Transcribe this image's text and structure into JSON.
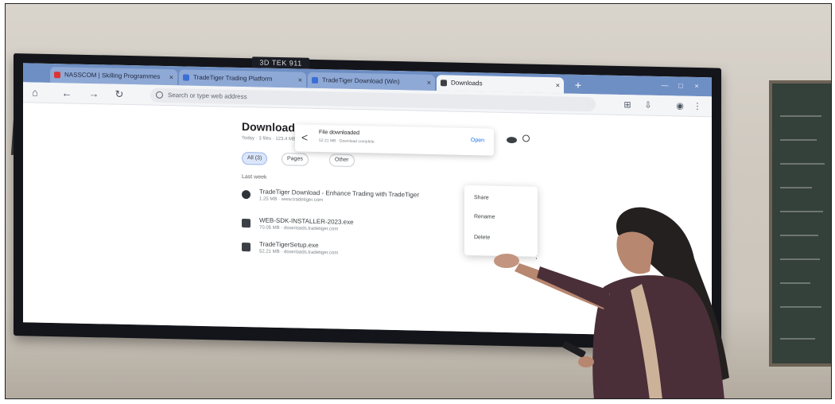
{
  "tv": {
    "label": "3D TEK 911"
  },
  "browser": {
    "tabs": [
      {
        "label": "NASSCOM | Skilling Programmes"
      },
      {
        "label": "TradeTiger Trading Platform"
      },
      {
        "label": "TradeTiger Download (Win)"
      },
      {
        "label": "Downloads"
      }
    ],
    "omnibox_placeholder": "Search or type web address",
    "new_tab_symbol": "+"
  },
  "downloads": {
    "title": "Download",
    "subtitle": "Today · 3 files · 123.4 MB",
    "filters": [
      "All (3)",
      "Pages",
      "Other"
    ],
    "section": "Last week",
    "items": [
      {
        "name": "TradeTiger Download - Enhance Trading with TradeTiger",
        "meta": "1.25 MB · www.tradetiger.com",
        "icon": "globe-icon"
      },
      {
        "name": "WEB-SDK-INSTALLER-2023.exe",
        "meta": "70.05 MB · downloads.tradetiger.com",
        "icon": "file-icon"
      },
      {
        "name": "TradeTigerSetup.exe",
        "meta": "52.21 MB · downloads.tradetiger.com",
        "icon": "file-icon"
      }
    ]
  },
  "bubble": {
    "title": "File downloaded",
    "subtitle": "52.21 MB · Download complete",
    "open": "Open"
  },
  "context_menu": [
    "Share",
    "Rename",
    "Delete"
  ],
  "colors": {
    "titlebar": "#6e8fc4",
    "screen_bg": "#f4f5f7",
    "accent": "#1a73e8"
  }
}
